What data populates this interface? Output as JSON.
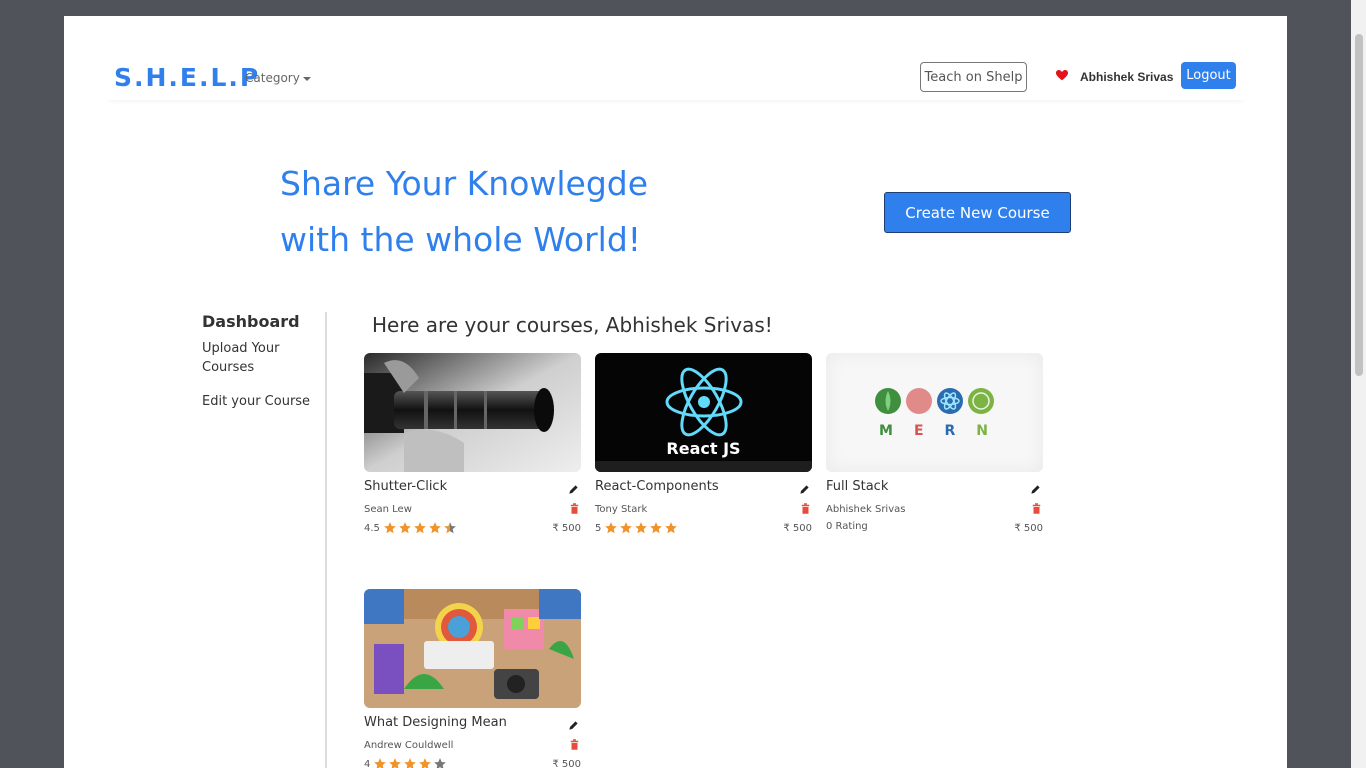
{
  "navbar": {
    "brand": "S.H.E.L.P",
    "category_label": "Category",
    "teach_label": "Teach on Shelp",
    "username": "Abhishek Srivas",
    "logout_label": "Logout"
  },
  "hero": {
    "line1": "Share Your Knowlegde",
    "line2": "with the whole World!",
    "create_label": "Create New Course"
  },
  "sidebar": {
    "heading": "Dashboard",
    "items": [
      {
        "label": "Upload Your Courses"
      },
      {
        "label": "Edit your Course"
      }
    ]
  },
  "courses": {
    "title": "Here are your courses, Abhishek Srivas!",
    "items": [
      {
        "title": "Shutter-Click",
        "author": "Sean Lew",
        "rating_text": "4.5",
        "rating": 4.5,
        "price": "₹ 500",
        "image": "camera-lens-photo"
      },
      {
        "title": "React-Components",
        "author": "Tony Stark",
        "rating_text": "5",
        "rating": 5,
        "price": "₹ 500",
        "image": "react-logo"
      },
      {
        "title": "Full Stack",
        "author": "Abhishek Srivas",
        "rating_text": "0 Rating",
        "rating": 0,
        "price": "₹ 500",
        "image": "mern-logo",
        "mern_letters": [
          "M",
          "E",
          "R",
          "N"
        ]
      },
      {
        "title": "What Designing Mean",
        "author": "Andrew Couldwell",
        "rating_text": "4",
        "rating": 4,
        "price": "₹ 500",
        "image": "design-desk-photo"
      }
    ],
    "thumb_labels": {
      "react": "React JS"
    }
  },
  "colors": {
    "accent": "#2f80ed",
    "star": "#f0932b",
    "danger": "#e74c3c",
    "heart": "#e3141b"
  }
}
